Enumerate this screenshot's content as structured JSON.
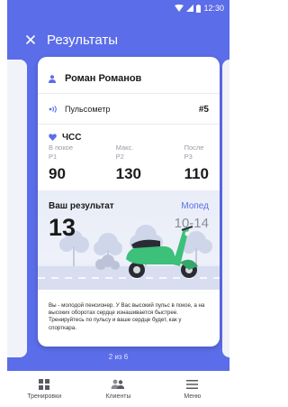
{
  "status_bar": {
    "time": "12:30"
  },
  "app_bar": {
    "title": "Результаты"
  },
  "card": {
    "user_name": "Роман Романов",
    "sensor": {
      "label": "Пульсометр",
      "number": "#5"
    },
    "heart_rate": {
      "title": "ЧСС",
      "columns": [
        {
          "sub1": "В покое",
          "sub2": "P1",
          "value": "90"
        },
        {
          "sub1": "Макс.",
          "sub2": "P2",
          "value": "130"
        },
        {
          "sub1": "После",
          "sub2": "P3",
          "value": "110"
        }
      ]
    },
    "result": {
      "label": "Ваш результат",
      "type": "Мопед",
      "score": "13",
      "range": "10-14"
    },
    "description": "Вы - молодой пенсионер. У Вас высокий пульс в покое, а на высоких оборотах сердце изнашивается быстрее. Тренируйтесь по пульсу и ваше сердце будет, как у спорткара."
  },
  "pager": "2 из 6",
  "bottom_nav": {
    "items": [
      {
        "label": "Тренировки",
        "icon": "grid-icon"
      },
      {
        "label": "Клиенты",
        "icon": "people-icon"
      },
      {
        "label": "Меню",
        "icon": "menu-icon"
      }
    ]
  },
  "colors": {
    "accent": "#5b6de8",
    "moped": "#3cc07a",
    "text": "#1a1a1a",
    "muted": "#9a9aa5"
  }
}
